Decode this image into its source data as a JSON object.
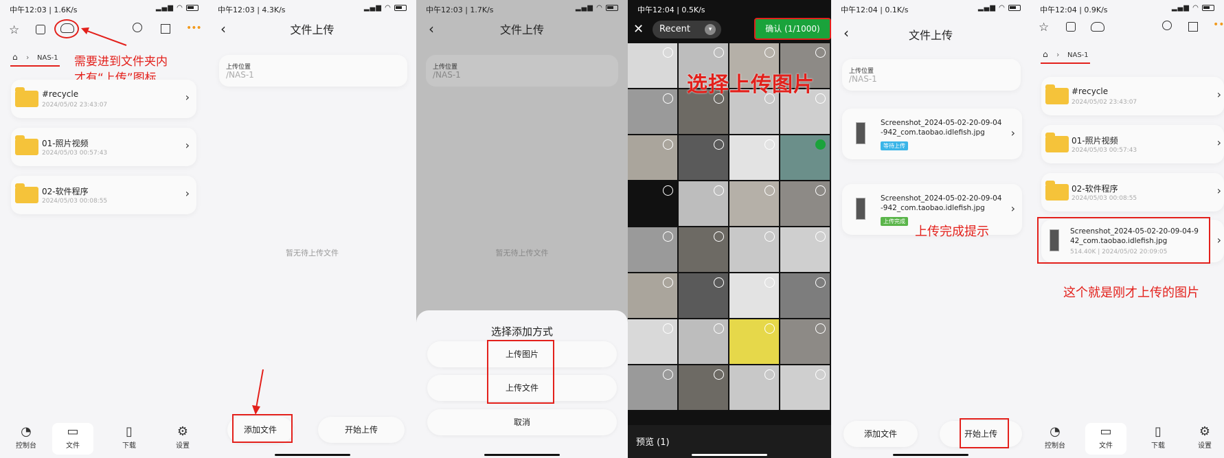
{
  "s1": {
    "status": {
      "time": "中午12:03 | 1.6K/s",
      "signal": "ᯤ ▮▮▮ ᯤ"
    },
    "breadcrumb": "NAS-1",
    "annotation": "需要进到文件夹内\n才有“上传”图标",
    "folders": [
      {
        "name": "#recycle",
        "date": "2024/05/02 23:43:07"
      },
      {
        "name": "01-照片视频",
        "date": "2024/05/03 00:57:43"
      },
      {
        "name": "02-软件程序",
        "date": "2024/05/03 00:08:55"
      }
    ],
    "nav": [
      "控制台",
      "文件",
      "下载",
      "设置"
    ]
  },
  "s2": {
    "status": {
      "time": "中午12:03 | 4.3K/s"
    },
    "title": "文件上传",
    "loc_label": "上传位置",
    "loc_value": "/NAS-1",
    "empty": "暂无待上传文件",
    "add_button": "添加文件",
    "start_button": "开始上传"
  },
  "s3": {
    "status": {
      "time": "中午12:03 | 1.7K/s"
    },
    "title": "文件上传",
    "loc_label": "上传位置",
    "loc_value": "/NAS-1",
    "empty": "暂无待上传文件",
    "sheet_title": "选择添加方式",
    "upload_image": "上传图片",
    "upload_file": "上传文件",
    "cancel": "取消"
  },
  "s4": {
    "status": {
      "time": "中午12:04 | 0.5K/s"
    },
    "album": "Recent",
    "confirm": "确认 (1/1000)",
    "annotation": "选择上传图片",
    "preview": "预览 (1)"
  },
  "s5": {
    "status": {
      "time": "中午12:04 | 0.1K/s"
    },
    "title": "文件上传",
    "loc_label": "上传位置",
    "loc_value": "/NAS-1",
    "files": [
      {
        "name": "Screenshot_2024-05-02-20-09-04\n-942_com.taobao.idlefish.jpg",
        "tag": "等待上传",
        "tag_color": "#3bb5e8"
      },
      {
        "name": "Screenshot_2024-05-02-20-09-04\n-942_com.taobao.idlefish.jpg",
        "tag": "上传完成",
        "tag_color": "#5ab54a"
      }
    ],
    "annotation": "上传完成提示",
    "add_button": "添加文件",
    "start_button": "开始上传"
  },
  "s6": {
    "status": {
      "time": "中午12:04 | 0.9K/s"
    },
    "breadcrumb": "NAS-1",
    "folders": [
      {
        "name": "#recycle",
        "date": "2024/05/02 23:43:07"
      },
      {
        "name": "01-照片视频",
        "date": "2024/05/03 00:57:43"
      },
      {
        "name": "02-软件程序",
        "date": "2024/05/03 00:08:55"
      }
    ],
    "file": {
      "name": "Screenshot_2024-05-02-20-09-04-9\n42_com.taobao.idlefish.jpg",
      "meta": "514.40K | 2024/05/02 20:09:05"
    },
    "annotation": "这个就是刚才上传的图片",
    "nav": [
      "控制台",
      "文件",
      "下载",
      "设置"
    ]
  },
  "colors": {
    "accent_red": "#e3201b",
    "folder": "#f5c33a",
    "confirm_green": "#1aa33b"
  }
}
